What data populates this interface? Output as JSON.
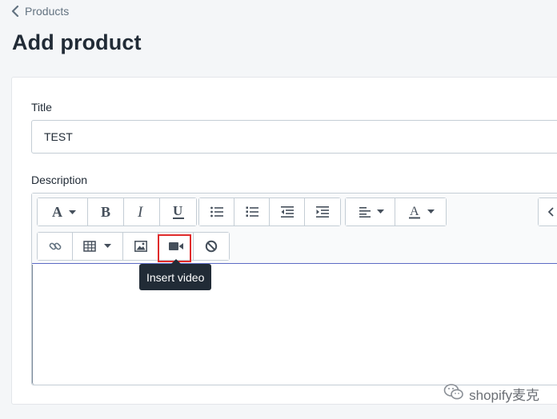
{
  "breadcrumb": {
    "label": "Products",
    "icon": "chevron-left-icon"
  },
  "page": {
    "title": "Add product"
  },
  "form": {
    "title_label": "Title",
    "title_value": "TEST",
    "description_label": "Description"
  },
  "toolbar": {
    "row1": [
      {
        "name": "font-style-button",
        "icon": "font-a-icon"
      },
      {
        "name": "bold-button",
        "icon": "bold-icon"
      },
      {
        "name": "italic-button",
        "icon": "italic-icon"
      },
      {
        "name": "underline-button",
        "icon": "underline-icon"
      },
      {
        "name": "bulleted-list-button",
        "icon": "bullet-list-icon"
      },
      {
        "name": "numbered-list-button",
        "icon": "numbered-list-icon"
      },
      {
        "name": "outdent-button",
        "icon": "outdent-icon"
      },
      {
        "name": "indent-button",
        "icon": "indent-icon"
      },
      {
        "name": "align-button",
        "icon": "align-left-icon"
      },
      {
        "name": "text-color-button",
        "icon": "text-color-icon"
      },
      {
        "name": "show-html-button",
        "icon": "code-icon"
      }
    ],
    "row2": [
      {
        "name": "insert-link-button",
        "icon": "link-icon"
      },
      {
        "name": "insert-table-button",
        "icon": "table-icon"
      },
      {
        "name": "insert-image-button",
        "icon": "image-icon"
      },
      {
        "name": "insert-video-button",
        "icon": "video-camera-icon"
      },
      {
        "name": "clear-formatting-button",
        "icon": "prohibit-icon"
      }
    ],
    "tooltip": "Insert video",
    "highlight_color": "#e02b2b"
  },
  "watermark": {
    "text": "shopify麦克",
    "icon": "wechat-icon"
  },
  "colors": {
    "background": "#f4f6f8",
    "card": "#ffffff",
    "tooltip_bg": "#212b36",
    "focus_border": "#5c6ac4"
  }
}
